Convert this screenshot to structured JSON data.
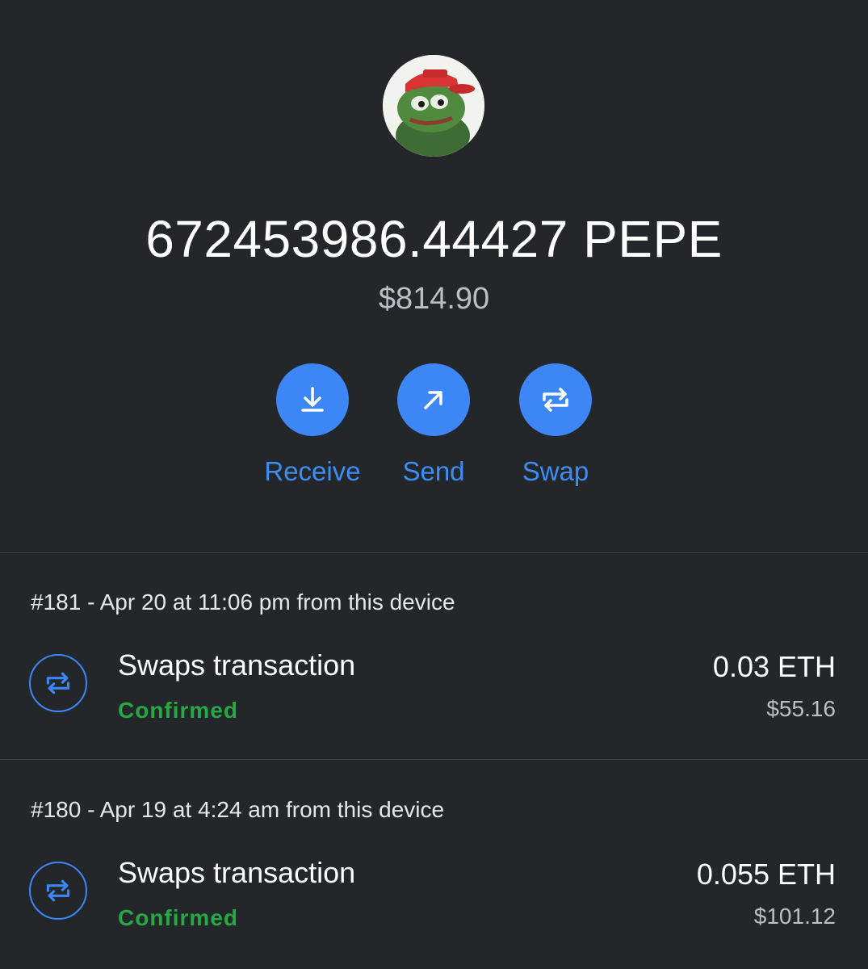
{
  "token": {
    "balance": "672453986.44427 PEPE",
    "fiat_value": "$814.90",
    "avatar_icon": "pepe-token-avatar"
  },
  "actions": [
    {
      "label": "Receive",
      "icon": "download-arrow-icon"
    },
    {
      "label": "Send",
      "icon": "diagonal-arrow-icon"
    },
    {
      "label": "Swap",
      "icon": "swap-arrows-icon"
    }
  ],
  "transactions": [
    {
      "meta": "#181 - Apr 20 at 11:06 pm from this device",
      "title": "Swaps transaction",
      "status": "Confirmed",
      "amount": "0.03 ETH",
      "amount_fiat": "$55.16"
    },
    {
      "meta": "#180 - Apr 19 at 4:24 am from this device",
      "title": "Swaps transaction",
      "status": "Confirmed",
      "amount": "0.055 ETH",
      "amount_fiat": "$101.12"
    }
  ],
  "colors": {
    "background": "#24272a",
    "accent": "#3d86f5",
    "confirmed": "#28a745",
    "muted": "#bbc0c5"
  }
}
